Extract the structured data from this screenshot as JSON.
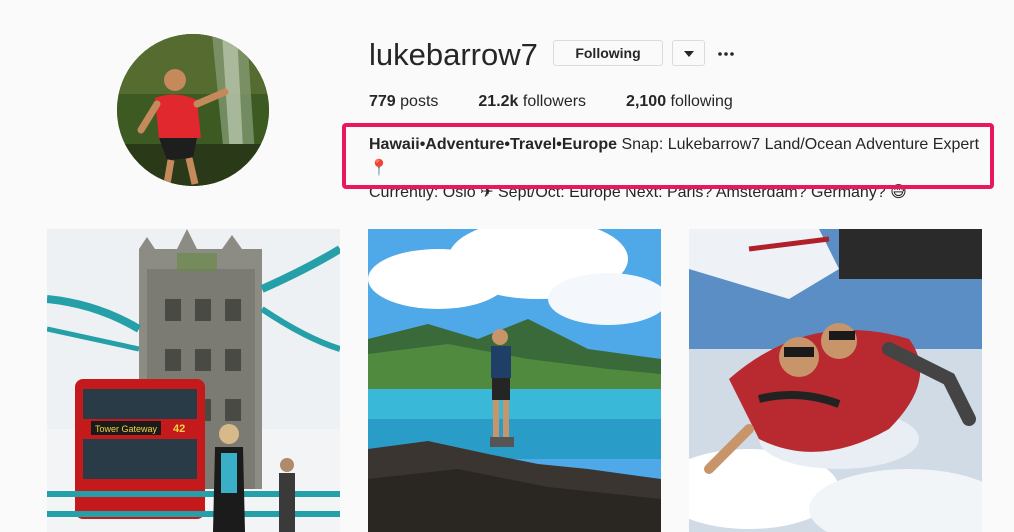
{
  "profile": {
    "username": "lukebarrow7",
    "follow_label": "Following",
    "stats": {
      "posts_count": "779",
      "posts_label": "posts",
      "followers_count": "21.2k",
      "followers_label": "followers",
      "following_count": "2,100",
      "following_label": "following"
    },
    "bio": {
      "bold": "Hawaii•Adventure•Travel•Europe",
      "line1_rest": " Snap: Lukebarrow7 Land/Ocean Adventure Expert📍",
      "line2": "Currently: Oslo ✈ Sept/Oct: Europe Next: Paris? Amsterdam? Germany? 😅"
    }
  },
  "posts": [
    {
      "subject": "tower-bridge-london",
      "bus_sign": "Tower Gateway",
      "bus_number": "42"
    },
    {
      "subject": "hiker-on-cliff-ocean"
    },
    {
      "subject": "tandem-skydive"
    }
  ],
  "colors": {
    "highlight": "#e8185f",
    "text": "#262626",
    "border": "#dbdbdb"
  }
}
